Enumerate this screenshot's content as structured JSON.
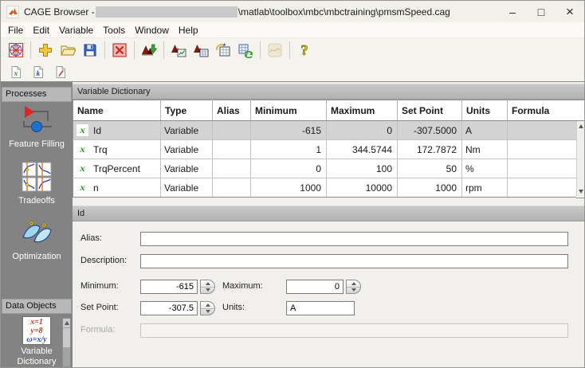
{
  "window": {
    "title_prefix": "CAGE Browser - ",
    "title_path": "\\matlab\\toolbox\\mbc\\mbctraining\\pmsmSpeed.cag",
    "minimize_glyph": "–",
    "maximize_glyph": "□",
    "close_glyph": "×"
  },
  "menu": {
    "items": [
      "File",
      "Edit",
      "Variable",
      "Tools",
      "Window",
      "Help"
    ]
  },
  "toolbar": {
    "main_buttons": [
      "mbc-model-browser",
      "new-project",
      "open-project",
      "save-project",
      "close-project",
      "import-calibration",
      "export-surface",
      "surface-table-view",
      "copy-table",
      "update-tables",
      "comparison-disabled",
      "help"
    ],
    "dictionary_buttons": [
      "new-variable",
      "new-constant",
      "new-formula"
    ]
  },
  "sidebar": {
    "processes_header": "Processes",
    "data_objects_header": "Data Objects",
    "items": [
      {
        "label": "Feature Filling"
      },
      {
        "label": "Tradeoffs"
      },
      {
        "label": "Optimization"
      },
      {
        "label": "Variable Dictionary"
      }
    ],
    "vardict_icon_lines": [
      "x=1",
      "y=8",
      "ω=x/y"
    ]
  },
  "variable_dictionary": {
    "pane_title": "Variable Dictionary",
    "columns": [
      "Name",
      "Type",
      "Alias",
      "Minimum",
      "Maximum",
      "Set Point",
      "Units",
      "Formula"
    ],
    "selected_row": "Id",
    "rows": [
      {
        "name": "Id",
        "type": "Variable",
        "alias": "",
        "minimum": "-615",
        "maximum": "0",
        "set_point": "-307.5000",
        "units": "A",
        "formula": ""
      },
      {
        "name": "Trq",
        "type": "Variable",
        "alias": "",
        "minimum": "1",
        "maximum": "344.5744",
        "set_point": "172.7872",
        "units": "Nm",
        "formula": ""
      },
      {
        "name": "TrqPercent",
        "type": "Variable",
        "alias": "",
        "minimum": "0",
        "maximum": "100",
        "set_point": "50",
        "units": "%",
        "formula": ""
      },
      {
        "name": "n",
        "type": "Variable",
        "alias": "",
        "minimum": "1000",
        "maximum": "10000",
        "set_point": "1000",
        "units": "rpm",
        "formula": ""
      }
    ]
  },
  "detail": {
    "pane_title": "Id",
    "alias_label": "Alias:",
    "alias_value": "",
    "description_label": "Description:",
    "description_value": "",
    "minimum_label": "Minimum:",
    "minimum_value": "-615",
    "maximum_label": "Maximum:",
    "maximum_value": "0",
    "set_point_label": "Set Point:",
    "set_point_value": "-307.5",
    "units_label": "Units:",
    "units_value": "A",
    "formula_label": "Formula:",
    "formula_value": ""
  }
}
